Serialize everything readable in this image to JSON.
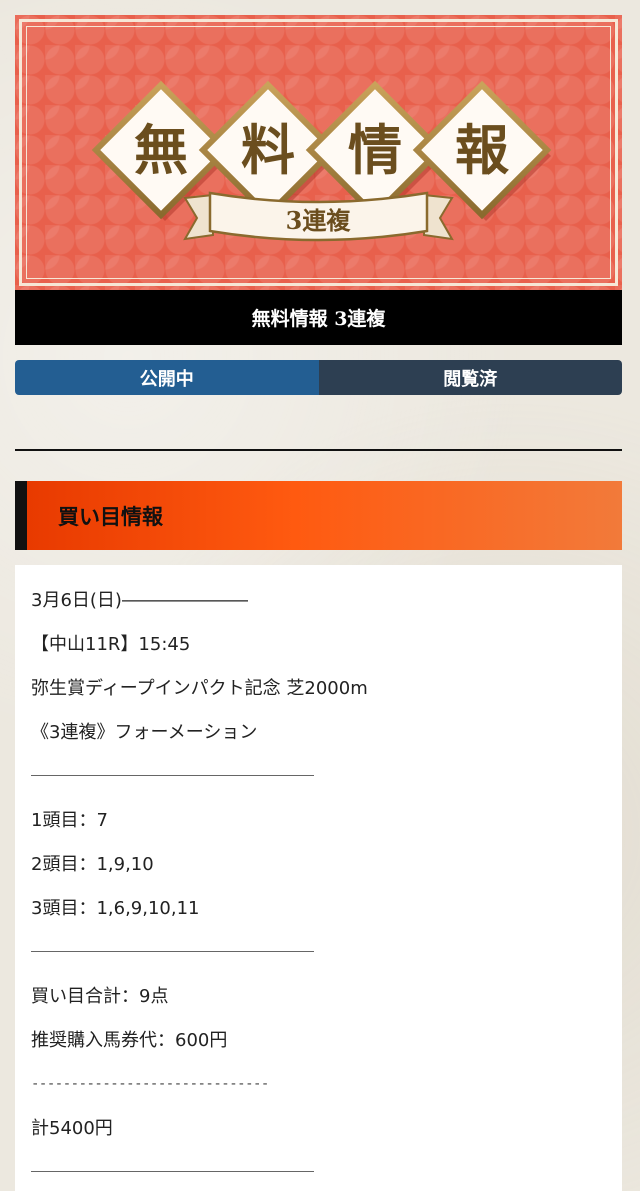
{
  "banner": {
    "chars": [
      "無",
      "料",
      "情",
      "報"
    ],
    "ribbon_text": "3連複",
    "colors": {
      "background": "#e8604c",
      "diamond": "#fffaf4",
      "gold": "#9a7a3c",
      "text": "#6b4e1e"
    }
  },
  "title_bar": {
    "text": "無料情報 3連複"
  },
  "tabs": [
    {
      "label": "公開中",
      "active": true
    },
    {
      "label": "閲覧済",
      "active": false
    }
  ],
  "section": {
    "title": "買い目情報"
  },
  "content": {
    "date_line": "3月6日(日)―――――――",
    "race_line": "【中山11R】15:45",
    "race_name": "弥生賞ディープインパクト記念 芝2000m",
    "bet_type": "《3連複》フォーメーション",
    "head1": "1頭目：7",
    "head2": "2頭目：1,9,10",
    "head3": "3頭目：1,6,9,10,11",
    "total_points": "買い目合計：9点",
    "recommended": "推奨購入馬券代：600円",
    "dashes": "------------------------------",
    "total": "計5400円"
  }
}
